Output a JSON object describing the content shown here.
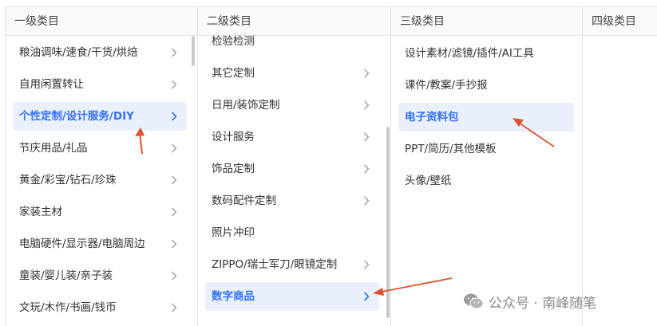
{
  "columns": [
    {
      "header": "一级类目",
      "items": [
        {
          "label": "粮油调味/速食/干货/烘焙",
          "chevron": true,
          "active": false
        },
        {
          "label": "自用闲置转让",
          "chevron": true,
          "active": false
        },
        {
          "label": "个性定制/设计服务/DIY",
          "chevron": true,
          "active": true
        },
        {
          "label": "节庆用品/礼品",
          "chevron": true,
          "active": false
        },
        {
          "label": "黄金/彩宝/钻石/珍珠",
          "chevron": true,
          "active": false
        },
        {
          "label": "家装主材",
          "chevron": true,
          "active": false
        },
        {
          "label": "电脑硬件/显示器/电脑周边",
          "chevron": true,
          "active": false
        },
        {
          "label": "童装/婴儿装/亲子装",
          "chevron": true,
          "active": false
        },
        {
          "label": "文玩/木作/书画/钱币",
          "chevron": true,
          "active": false
        }
      ]
    },
    {
      "header": "二级类目",
      "items": [
        {
          "label": "检验检测",
          "chevron": false,
          "active": false
        },
        {
          "label": "其它定制",
          "chevron": true,
          "active": false
        },
        {
          "label": "日用/装饰定制",
          "chevron": true,
          "active": false
        },
        {
          "label": "设计服务",
          "chevron": true,
          "active": false
        },
        {
          "label": "饰品定制",
          "chevron": true,
          "active": false
        },
        {
          "label": "数码配件定制",
          "chevron": true,
          "active": false
        },
        {
          "label": "照片冲印",
          "chevron": false,
          "active": false
        },
        {
          "label": "ZIPPO/瑞士军刀/眼镜定制",
          "chevron": true,
          "active": false
        },
        {
          "label": "数字商品",
          "chevron": true,
          "active": true
        }
      ]
    },
    {
      "header": "三级类目",
      "items": [
        {
          "label": "设计素材/滤镜/插件/AI工具",
          "chevron": false,
          "active": false
        },
        {
          "label": "课件/教案/手抄报",
          "chevron": false,
          "active": false
        },
        {
          "label": "电子资料包",
          "chevron": false,
          "active": true
        },
        {
          "label": "PPT/简历/其他模板",
          "chevron": false,
          "active": false
        },
        {
          "label": "头像/壁纸",
          "chevron": false,
          "active": false
        }
      ]
    },
    {
      "header": "四级类目",
      "items": []
    }
  ],
  "watermark": {
    "text": "公众号 · 南峰随笔",
    "icon": "wechat-icon"
  },
  "colors": {
    "accent": "#3370ff",
    "active_bg": "#eaf0fd",
    "arrow": "#e0522d",
    "border": "#e4e4e4"
  }
}
